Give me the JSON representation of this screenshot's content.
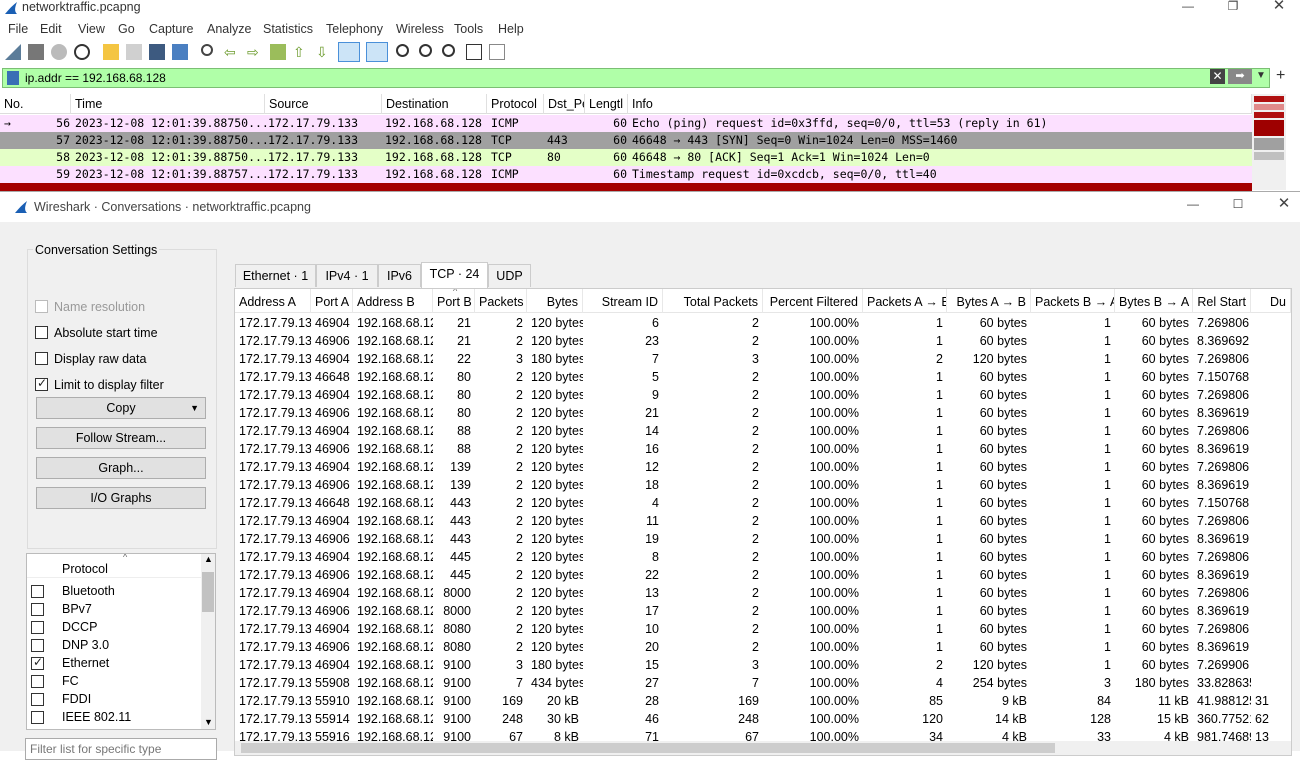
{
  "main_window": {
    "title": "networktraffic.pcapng",
    "menu": [
      "File",
      "Edit",
      "View",
      "Go",
      "Capture",
      "Analyze",
      "Statistics",
      "Telephony",
      "Wireless",
      "Tools",
      "Help"
    ],
    "filter": {
      "value": "ip.addr == 192.168.68.128",
      "bg_color": "#b0ffa8"
    },
    "packet_columns": [
      "No.",
      "Time",
      "Source",
      "Destination",
      "Protocol",
      "Dst_Pe",
      "Lengtl",
      "Info"
    ],
    "packets": [
      {
        "no": "56",
        "time": "2023-12-08 12:01:39.88750...",
        "src": "172.17.79.133",
        "dst": "192.168.68.128",
        "proto": "ICMP",
        "dport": "",
        "len": "60",
        "info": "Echo (ping) request  id=0x3ffd, seq=0/0, ttl=53 (reply in 61)",
        "bg": "#fce0ff",
        "marker": "→"
      },
      {
        "no": "57",
        "time": "2023-12-08 12:01:39.88750...",
        "src": "172.17.79.133",
        "dst": "192.168.68.128",
        "proto": "TCP",
        "dport": "443",
        "len": "60",
        "info": "46648 → 443 [SYN] Seq=0 Win=1024 Len=0 MSS=1460",
        "bg": "#a0a0a0",
        "marker": ""
      },
      {
        "no": "58",
        "time": "2023-12-08 12:01:39.88750...",
        "src": "172.17.79.133",
        "dst": "192.168.68.128",
        "proto": "TCP",
        "dport": "80",
        "len": "60",
        "info": "46648 → 80 [ACK] Seq=1 Ack=1 Win=1024 Len=0",
        "bg": "#e4ffc7",
        "marker": ""
      },
      {
        "no": "59",
        "time": "2023-12-08 12:01:39.88757...",
        "src": "172.17.79.133",
        "dst": "192.168.68.128",
        "proto": "ICMP",
        "dport": "",
        "len": "60",
        "info": "Timestamp request    id=0xcdcb, seq=0/0, ttl=40",
        "bg": "#fce0ff",
        "marker": ""
      }
    ]
  },
  "dialog": {
    "title": "Wireshark · Conversations · networktraffic.pcapng",
    "settings_title": "Conversation Settings",
    "options": [
      {
        "label": "Name resolution",
        "checked": false,
        "disabled": true
      },
      {
        "label": "Absolute start time",
        "checked": false,
        "disabled": false
      },
      {
        "label": "Display raw data",
        "checked": false,
        "disabled": false
      },
      {
        "label": "Limit to display filter",
        "checked": true,
        "disabled": false
      }
    ],
    "buttons": {
      "copy": "Copy",
      "follow": "Follow Stream...",
      "graph": "Graph...",
      "io": "I/O Graphs"
    },
    "protocol_header": "Protocol",
    "protocols": [
      {
        "name": "Bluetooth",
        "checked": false
      },
      {
        "name": "BPv7",
        "checked": false
      },
      {
        "name": "DCCP",
        "checked": false
      },
      {
        "name": "DNP 3.0",
        "checked": false
      },
      {
        "name": "Ethernet",
        "checked": true
      },
      {
        "name": "FC",
        "checked": false
      },
      {
        "name": "FDDI",
        "checked": false
      },
      {
        "name": "IEEE 802.11",
        "checked": false
      }
    ],
    "filter_placeholder": "Filter list for specific type",
    "tabs": [
      "Ethernet · 1",
      "IPv4 · 1",
      "IPv6",
      "TCP · 24",
      "UDP"
    ],
    "active_tab": 3,
    "columns": [
      "Address A",
      "Port A",
      "Address B",
      "Port B",
      "Packets",
      "Bytes",
      "Stream ID",
      "Total Packets",
      "Percent Filtered",
      "Packets A → B",
      "Bytes A → B",
      "Packets B → A",
      "Bytes B → A",
      "Rel Start",
      "Du"
    ],
    "rows": [
      [
        "172.17.79.133",
        "46904",
        "192.168.68.128",
        "21",
        "2",
        "120 bytes",
        "6",
        "2",
        "100.00%",
        "1",
        "60 bytes",
        "1",
        "60 bytes",
        "7.269806",
        ""
      ],
      [
        "172.17.79.133",
        "46906",
        "192.168.68.128",
        "21",
        "2",
        "120 bytes",
        "23",
        "2",
        "100.00%",
        "1",
        "60 bytes",
        "1",
        "60 bytes",
        "8.369692",
        ""
      ],
      [
        "172.17.79.133",
        "46904",
        "192.168.68.128",
        "22",
        "3",
        "180 bytes",
        "7",
        "3",
        "100.00%",
        "2",
        "120 bytes",
        "1",
        "60 bytes",
        "7.269806",
        ""
      ],
      [
        "172.17.79.133",
        "46648",
        "192.168.68.128",
        "80",
        "2",
        "120 bytes",
        "5",
        "2",
        "100.00%",
        "1",
        "60 bytes",
        "1",
        "60 bytes",
        "7.150768",
        ""
      ],
      [
        "172.17.79.133",
        "46904",
        "192.168.68.128",
        "80",
        "2",
        "120 bytes",
        "9",
        "2",
        "100.00%",
        "1",
        "60 bytes",
        "1",
        "60 bytes",
        "7.269806",
        ""
      ],
      [
        "172.17.79.133",
        "46906",
        "192.168.68.128",
        "80",
        "2",
        "120 bytes",
        "21",
        "2",
        "100.00%",
        "1",
        "60 bytes",
        "1",
        "60 bytes",
        "8.369619",
        ""
      ],
      [
        "172.17.79.133",
        "46904",
        "192.168.68.128",
        "88",
        "2",
        "120 bytes",
        "14",
        "2",
        "100.00%",
        "1",
        "60 bytes",
        "1",
        "60 bytes",
        "7.269806",
        ""
      ],
      [
        "172.17.79.133",
        "46906",
        "192.168.68.128",
        "88",
        "2",
        "120 bytes",
        "16",
        "2",
        "100.00%",
        "1",
        "60 bytes",
        "1",
        "60 bytes",
        "8.369619",
        ""
      ],
      [
        "172.17.79.133",
        "46904",
        "192.168.68.128",
        "139",
        "2",
        "120 bytes",
        "12",
        "2",
        "100.00%",
        "1",
        "60 bytes",
        "1",
        "60 bytes",
        "7.269806",
        ""
      ],
      [
        "172.17.79.133",
        "46906",
        "192.168.68.128",
        "139",
        "2",
        "120 bytes",
        "18",
        "2",
        "100.00%",
        "1",
        "60 bytes",
        "1",
        "60 bytes",
        "8.369619",
        ""
      ],
      [
        "172.17.79.133",
        "46648",
        "192.168.68.128",
        "443",
        "2",
        "120 bytes",
        "4",
        "2",
        "100.00%",
        "1",
        "60 bytes",
        "1",
        "60 bytes",
        "7.150768",
        ""
      ],
      [
        "172.17.79.133",
        "46904",
        "192.168.68.128",
        "443",
        "2",
        "120 bytes",
        "11",
        "2",
        "100.00%",
        "1",
        "60 bytes",
        "1",
        "60 bytes",
        "7.269806",
        ""
      ],
      [
        "172.17.79.133",
        "46906",
        "192.168.68.128",
        "443",
        "2",
        "120 bytes",
        "19",
        "2",
        "100.00%",
        "1",
        "60 bytes",
        "1",
        "60 bytes",
        "8.369619",
        ""
      ],
      [
        "172.17.79.133",
        "46904",
        "192.168.68.128",
        "445",
        "2",
        "120 bytes",
        "8",
        "2",
        "100.00%",
        "1",
        "60 bytes",
        "1",
        "60 bytes",
        "7.269806",
        ""
      ],
      [
        "172.17.79.133",
        "46906",
        "192.168.68.128",
        "445",
        "2",
        "120 bytes",
        "22",
        "2",
        "100.00%",
        "1",
        "60 bytes",
        "1",
        "60 bytes",
        "8.369619",
        ""
      ],
      [
        "172.17.79.133",
        "46904",
        "192.168.68.128",
        "8000",
        "2",
        "120 bytes",
        "13",
        "2",
        "100.00%",
        "1",
        "60 bytes",
        "1",
        "60 bytes",
        "7.269806",
        ""
      ],
      [
        "172.17.79.133",
        "46906",
        "192.168.68.128",
        "8000",
        "2",
        "120 bytes",
        "17",
        "2",
        "100.00%",
        "1",
        "60 bytes",
        "1",
        "60 bytes",
        "8.369619",
        ""
      ],
      [
        "172.17.79.133",
        "46904",
        "192.168.68.128",
        "8080",
        "2",
        "120 bytes",
        "10",
        "2",
        "100.00%",
        "1",
        "60 bytes",
        "1",
        "60 bytes",
        "7.269806",
        ""
      ],
      [
        "172.17.79.133",
        "46906",
        "192.168.68.128",
        "8080",
        "2",
        "120 bytes",
        "20",
        "2",
        "100.00%",
        "1",
        "60 bytes",
        "1",
        "60 bytes",
        "8.369619",
        ""
      ],
      [
        "172.17.79.133",
        "46904",
        "192.168.68.128",
        "9100",
        "3",
        "180 bytes",
        "15",
        "3",
        "100.00%",
        "2",
        "120 bytes",
        "1",
        "60 bytes",
        "7.269906",
        ""
      ],
      [
        "172.17.79.133",
        "55908",
        "192.168.68.128",
        "9100",
        "7",
        "434 bytes",
        "27",
        "7",
        "100.00%",
        "4",
        "254 bytes",
        "3",
        "180 bytes",
        "33.828635",
        ""
      ],
      [
        "172.17.79.133",
        "55910",
        "192.168.68.128",
        "9100",
        "169",
        "20 kB",
        "28",
        "169",
        "100.00%",
        "85",
        "9 kB",
        "84",
        "11 kB",
        "41.988125",
        "31"
      ],
      [
        "172.17.79.133",
        "55914",
        "192.168.68.128",
        "9100",
        "248",
        "30 kB",
        "46",
        "248",
        "100.00%",
        "120",
        "14 kB",
        "128",
        "15 kB",
        "360.775216",
        "62"
      ],
      [
        "172.17.79.133",
        "55916",
        "192.168.68.128",
        "9100",
        "67",
        "8 kB",
        "71",
        "67",
        "100.00%",
        "34",
        "4 kB",
        "33",
        "4 kB",
        "981.746897",
        "13"
      ]
    ]
  }
}
